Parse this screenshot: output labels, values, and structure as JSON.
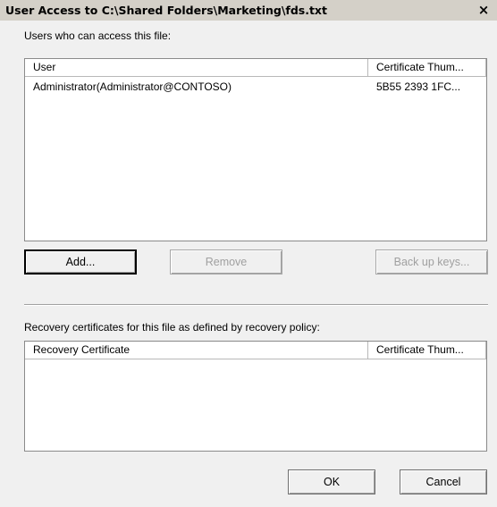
{
  "window": {
    "title": "User Access to C:\\Shared Folders\\Marketing\\fds.txt",
    "close_glyph": "×"
  },
  "users_section": {
    "label": "Users who can access this file:",
    "columns": [
      "User",
      "Certificate Thum..."
    ],
    "rows": [
      {
        "user": "Administrator(Administrator@CONTOSO)",
        "thumbprint": "5B55 2393 1FC..."
      }
    ]
  },
  "user_buttons": {
    "add_label": "Add...",
    "remove_label": "Remove",
    "backup_label": "Back up keys..."
  },
  "recovery_section": {
    "label": "Recovery certificates for this file as defined by recovery policy:",
    "columns": [
      "Recovery Certificate",
      "Certificate Thum..."
    ],
    "rows": []
  },
  "footer": {
    "ok_label": "OK",
    "cancel_label": "Cancel"
  }
}
